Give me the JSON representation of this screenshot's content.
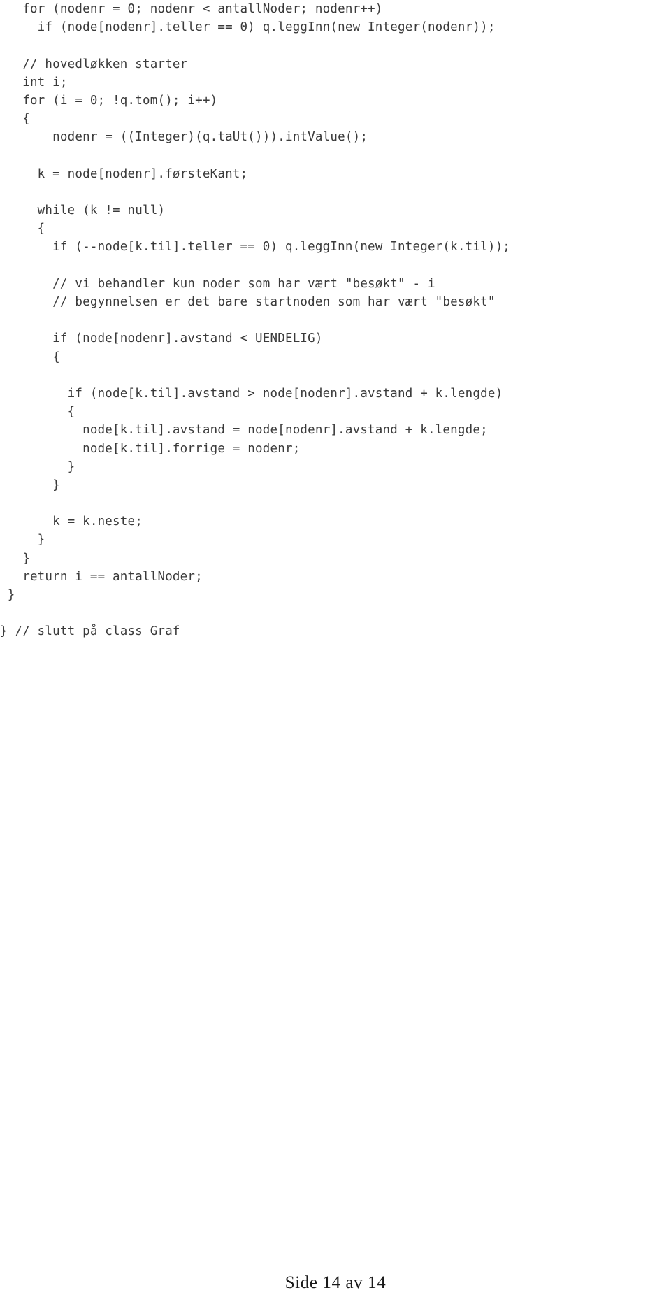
{
  "document": {
    "type": "code-listing",
    "language": "Java",
    "text_color": "#3a3a3a",
    "background_color": "#ffffff"
  },
  "code": {
    "lines": [
      "   for (nodenr = 0; nodenr < antallNoder; nodenr++)",
      "     if (node[nodenr].teller == 0) q.leggInn(new Integer(nodenr));",
      "",
      "   // hovedløkken starter",
      "   int i;",
      "   for (i = 0; !q.tom(); i++)",
      "   {",
      "       nodenr = ((Integer)(q.taUt())).intValue();",
      "",
      "     k = node[nodenr].førsteKant;",
      "",
      "     while (k != null)",
      "     {",
      "       if (--node[k.til].teller == 0) q.leggInn(new Integer(k.til));",
      "",
      "       // vi behandler kun noder som har vært \"besøkt\" - i",
      "       // begynnelsen er det bare startnoden som har vært \"besøkt\"",
      "",
      "       if (node[nodenr].avstand < UENDELIG)",
      "       {",
      "",
      "         if (node[k.til].avstand > node[nodenr].avstand + k.lengde)",
      "         {",
      "           node[k.til].avstand = node[nodenr].avstand + k.lengde;",
      "           node[k.til].forrige = nodenr;",
      "         }",
      "       }",
      "",
      "       k = k.neste;",
      "     }",
      "   }",
      "   return i == antallNoder;",
      " }",
      "",
      "} // slutt på class Graf"
    ]
  },
  "footer": {
    "page_label": "Side 14 av 14",
    "page_number": 14,
    "total_pages": 14
  }
}
